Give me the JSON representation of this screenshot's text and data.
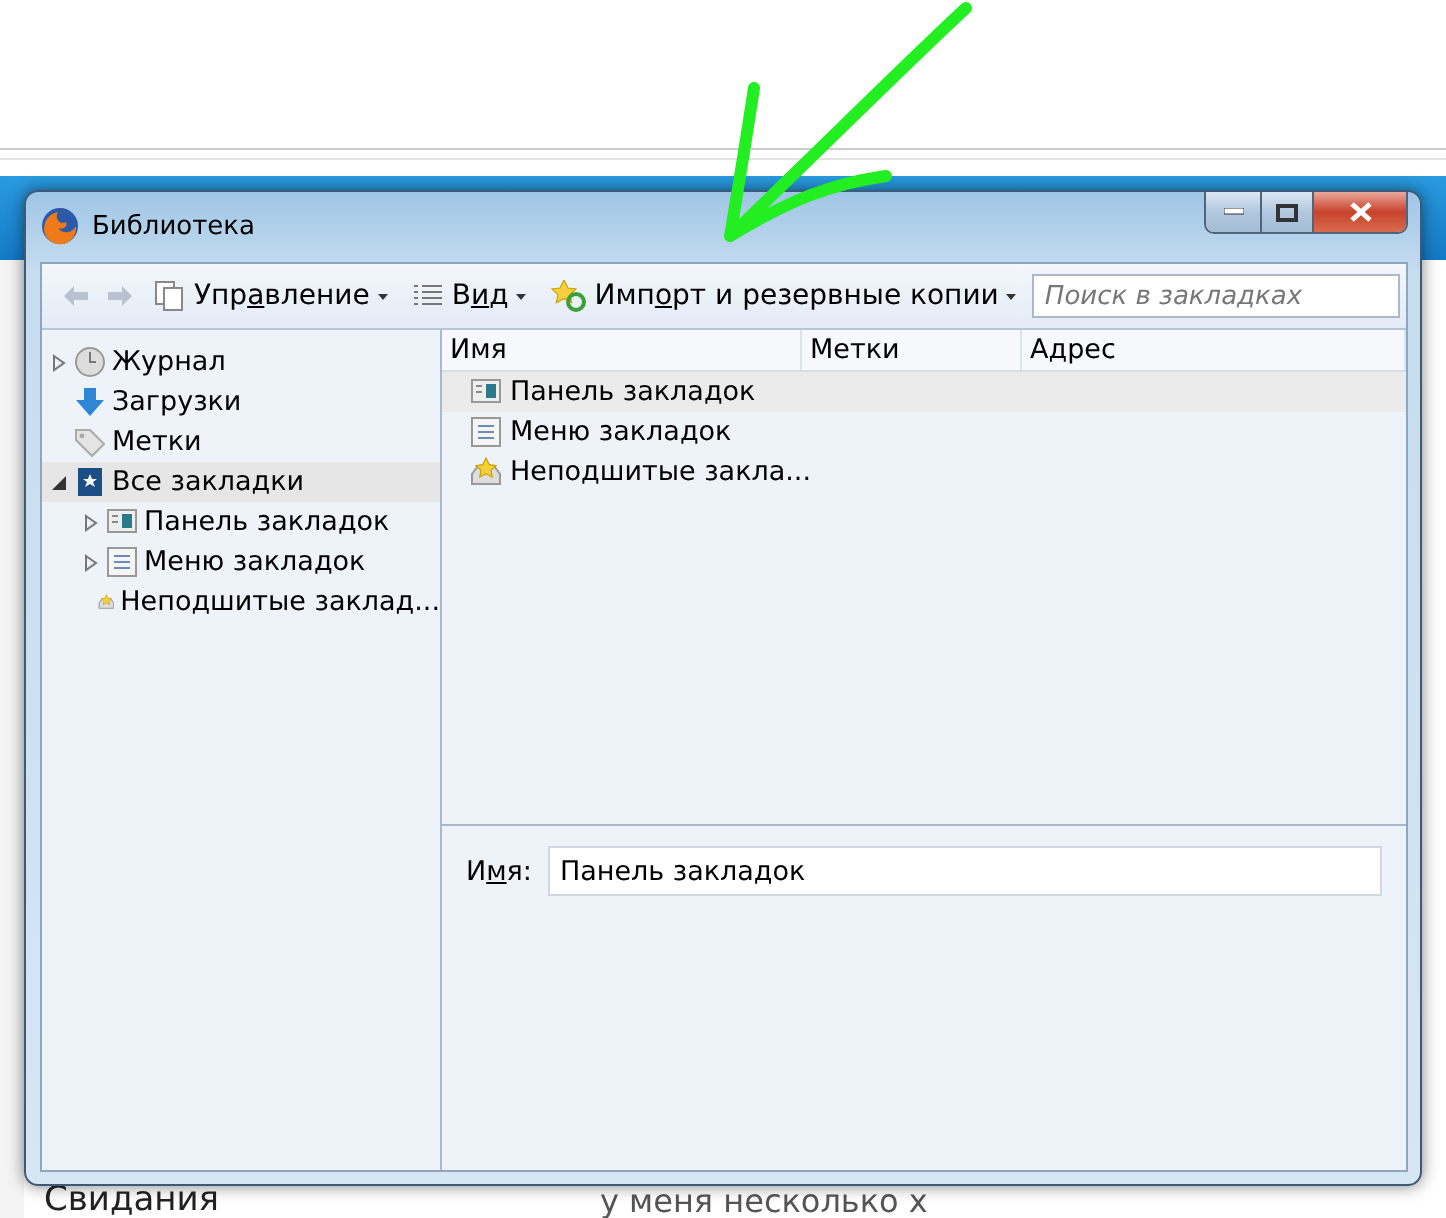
{
  "background_page": {
    "left_heading": "Свидания",
    "post_snippet": "у меня несколько х"
  },
  "window": {
    "title": "Библиотека"
  },
  "toolbar": {
    "menus": [
      {
        "label_parts": [
          "Упр",
          "а",
          "вление"
        ],
        "kind": "organize"
      },
      {
        "label_parts": [
          "В",
          "и",
          "д"
        ],
        "kind": "view"
      },
      {
        "label_parts": [
          "Имп",
          "о",
          "рт и резервные копии"
        ],
        "kind": "import"
      }
    ],
    "search": {
      "placeholder": "Поиск в закладках"
    }
  },
  "sidebar": {
    "items": [
      {
        "label": "Журнал",
        "kind": "history",
        "expanded": false,
        "has_children": true,
        "selected": false
      },
      {
        "label": "Загрузки",
        "kind": "downloads",
        "has_children": false,
        "selected": false
      },
      {
        "label": "Метки",
        "kind": "tags",
        "has_children": false,
        "selected": false
      },
      {
        "label": "Все закладки",
        "kind": "bookmarks",
        "expanded": true,
        "has_children": true,
        "selected": true,
        "children": [
          {
            "label": "Панель закладок",
            "kind": "toolbar",
            "expanded": false,
            "has_children": true,
            "selected": false
          },
          {
            "label": "Меню закладок",
            "kind": "menu",
            "expanded": false,
            "has_children": true,
            "selected": false
          },
          {
            "label": "Неподшитые заклад...",
            "kind": "unsorted",
            "has_children": false,
            "selected": false
          }
        ]
      }
    ]
  },
  "table": {
    "columns": [
      "Имя",
      "Метки",
      "Адрес"
    ],
    "rows": [
      {
        "name": "Панель закладок",
        "kind": "toolbar",
        "selected": true
      },
      {
        "name": "Меню закладок",
        "kind": "menu",
        "selected": false
      },
      {
        "name": "Неподшитые закла...",
        "kind": "unsorted",
        "selected": false
      }
    ]
  },
  "details": {
    "label_parts": [
      "И",
      "м",
      "я:"
    ],
    "value": "Панель закладок"
  }
}
